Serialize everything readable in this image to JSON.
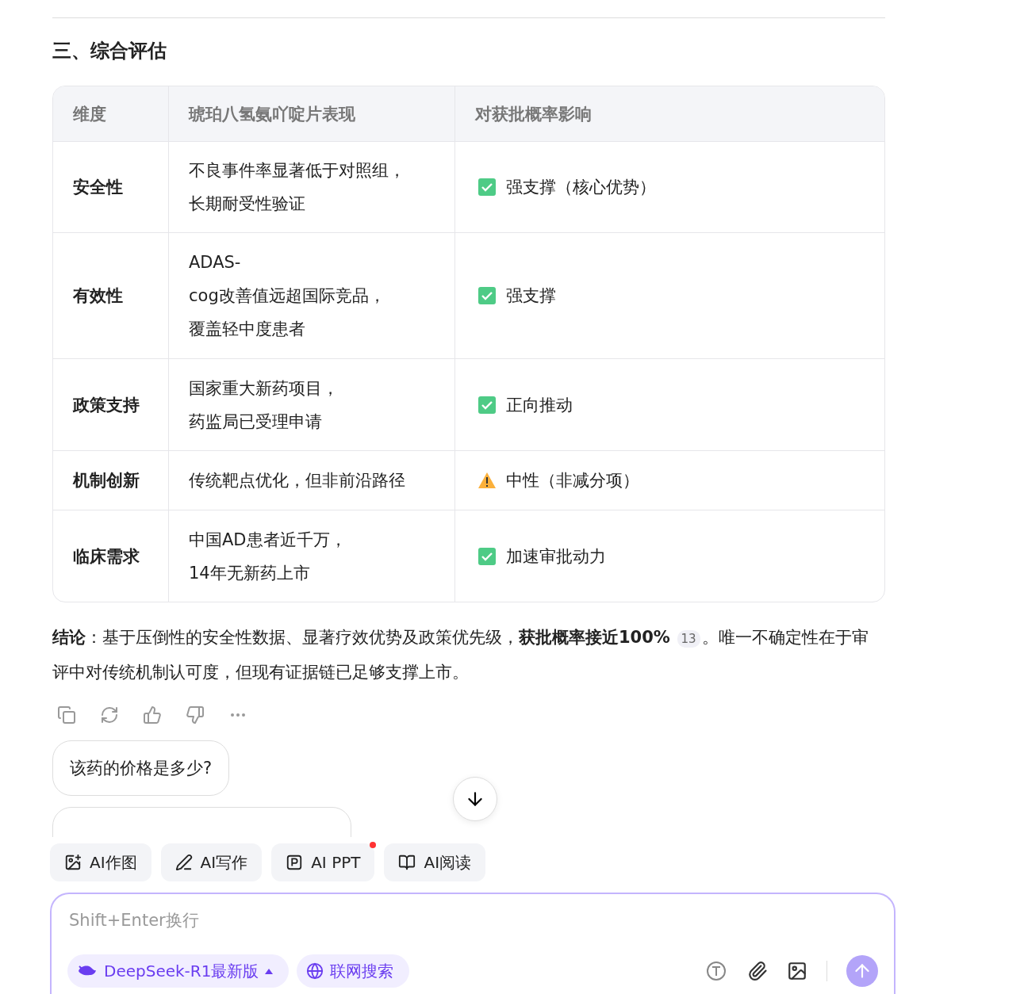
{
  "section_title": "三、综合评估",
  "table": {
    "columns": [
      "维度",
      "琥珀八氢氨吖啶片表现",
      "对获批概率影响"
    ],
    "rows": [
      {
        "dimension": "安全性",
        "performance": [
          "不良事件率显著低于对照组，",
          "长期耐受性验证"
        ],
        "impact": {
          "kind": "check",
          "text": "强支撑（核心优势）"
        }
      },
      {
        "dimension": "有效性",
        "performance": [
          "ADAS-",
          "cog改善值远超国际竞品，",
          "覆盖轻中度患者"
        ],
        "impact": {
          "kind": "check",
          "text": "强支撑"
        }
      },
      {
        "dimension": "政策支持",
        "performance": [
          "国家重大新药项目，",
          "药监局已受理申请"
        ],
        "impact": {
          "kind": "check",
          "text": "正向推动"
        }
      },
      {
        "dimension": "机制创新",
        "performance": [
          "传统靶点优化，但非前沿路径"
        ],
        "impact": {
          "kind": "warning",
          "text": "中性（非减分项）"
        }
      },
      {
        "dimension": "临床需求",
        "performance": [
          "中国AD患者近千万，",
          "14年无新药上市"
        ],
        "impact": {
          "kind": "check",
          "text": "加速审批动力"
        }
      }
    ]
  },
  "conclusion": {
    "before": "**结论**：基于压倒性的安全性数据、显著疗效优势及政策优先级，**获批概率接近100%**",
    "citation": "13",
    "after": "。唯一不确定性在于审评中对传统机制认可度，但现有证据链已足够支撑上市。"
  },
  "suggestions": [
    "该药的价格是多少?"
  ],
  "tools": [
    {
      "kind": "image",
      "label": "AI作图",
      "badge": false
    },
    {
      "kind": "write",
      "label": "AI写作",
      "badge": false
    },
    {
      "kind": "ppt",
      "label": "AI PPT",
      "badge": true
    },
    {
      "kind": "read",
      "label": "AI阅读",
      "badge": false
    }
  ],
  "input": {
    "placeholder": "Shift+Enter换行"
  },
  "model": {
    "label": "DeepSeek-R1最新版"
  },
  "web_search": {
    "label": "联网搜索"
  }
}
